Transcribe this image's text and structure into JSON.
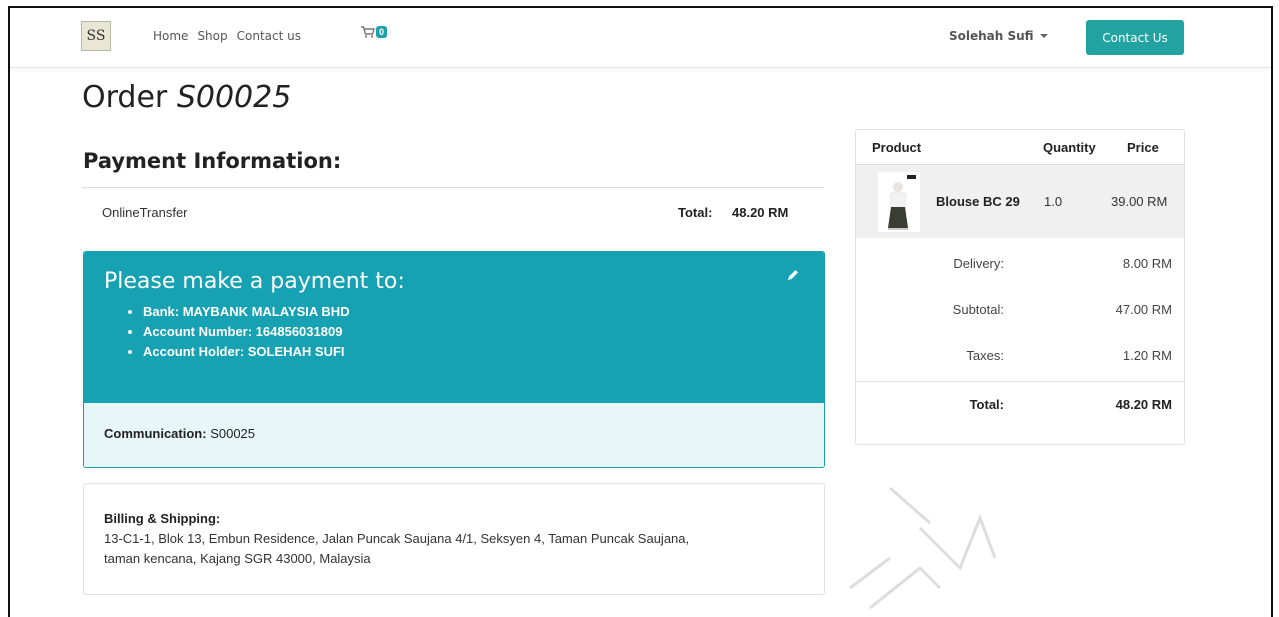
{
  "navbar": {
    "logo_text": "SS",
    "links": [
      "Home",
      "Shop",
      "Contact us"
    ],
    "cart_count": "0",
    "user_name": "Solehah Sufi",
    "contact_button": "Contact Us"
  },
  "order": {
    "title_prefix": "Order",
    "number": "S00025"
  },
  "payment_info": {
    "title": "Payment Information:",
    "method": "OnlineTransfer",
    "total_label": "Total:",
    "total_value": "48.20 RM"
  },
  "payment_panel": {
    "heading": "Please make a payment to:",
    "items": [
      "Bank:  MAYBANK MALAYSIA BHD",
      "Account Number: 164856031809",
      "Account Holder: SOLEHAH SUFI"
    ],
    "communication_label": "Communication:",
    "communication_value": "S00025"
  },
  "billing": {
    "label": "Billing & Shipping:",
    "line1": "13-C1-1, Blok 13, Embun Residence, Jalan Puncak Saujana 4/1, Seksyen 4, Taman Puncak Saujana,",
    "line2": "taman kencana, Kajang SGR 43000, Malaysia"
  },
  "summary": {
    "headers": [
      "Product",
      "Quantity",
      "Price"
    ],
    "item": {
      "name": "Blouse BC 29",
      "qty": "1.0",
      "price": "39.00 RM"
    },
    "rows": [
      {
        "label": "Delivery:",
        "value": "8.00 RM"
      },
      {
        "label": "Subtotal:",
        "value": "47.00 RM"
      },
      {
        "label": "Taxes:",
        "value": "1.20 RM"
      }
    ],
    "total": {
      "label": "Total:",
      "value": "48.20 RM"
    }
  },
  "colors": {
    "accent": "#17a2b3",
    "button": "#22a3a1",
    "panel_light": "#e7f6f7"
  },
  "icons": [
    "cart-icon",
    "caret-down-icon",
    "pencil-icon"
  ]
}
